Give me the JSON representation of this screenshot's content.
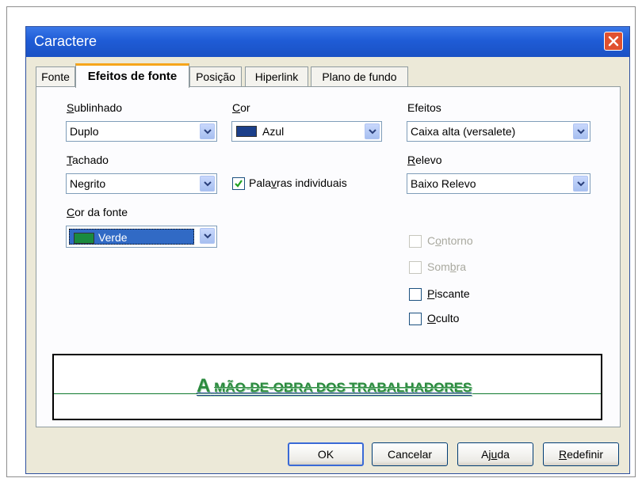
{
  "window": {
    "title": "Caractere"
  },
  "tabs": [
    {
      "label": "Fonte"
    },
    {
      "label": "Efeitos de fonte"
    },
    {
      "label": "Posição"
    },
    {
      "label": "Hiperlink"
    },
    {
      "label": "Plano de fundo"
    }
  ],
  "sublinhado": {
    "label_u": "S",
    "label_rest": "ublinhado",
    "value": "Duplo"
  },
  "tachado": {
    "label_u": "T",
    "label_rest": "achado",
    "value": "Negrito"
  },
  "cor_fonte": {
    "label_u": "C",
    "label_rest": "or da fonte",
    "value": "Verde",
    "swatch_color": "#1a8a3e"
  },
  "cor": {
    "label_u": "C",
    "label_rest": "or",
    "value": "Azul",
    "swatch_color": "#1b3f8a"
  },
  "palavras": {
    "label_pre": "Pala",
    "label_u": "v",
    "label_post": "ras individuais",
    "checked": true
  },
  "efeitos": {
    "label": "Efeitos",
    "value": "Caixa alta (versalete)"
  },
  "relevo": {
    "label_u": "R",
    "label_rest": "elevo",
    "value": "Baixo Relevo"
  },
  "contorno": {
    "label_pre": "C",
    "label_u": "o",
    "label_post": "ntorno",
    "enabled": false
  },
  "sombra": {
    "label_pre": "Som",
    "label_u": "b",
    "label_post": "ra",
    "enabled": false
  },
  "piscante": {
    "label_u": "P",
    "label_rest": "iscante",
    "checked": false
  },
  "oculto": {
    "label_u": "O",
    "label_rest": "culto",
    "checked": false
  },
  "preview": {
    "first": "A",
    "rest": "MÃO-DE-OBRA DOS TRABALHADORES"
  },
  "buttons": {
    "ok": "OK",
    "cancel": "Cancelar",
    "help_pre": "Aj",
    "help_u": "u",
    "help_post": "da",
    "reset_u": "R",
    "reset_rest": "edefinir"
  },
  "colors": {
    "titlebar": "#1f5cd6",
    "dialog_bg": "#ece9d8",
    "active_tab_accent": "#f6a51a",
    "preview_text": "#2b8a3e"
  }
}
